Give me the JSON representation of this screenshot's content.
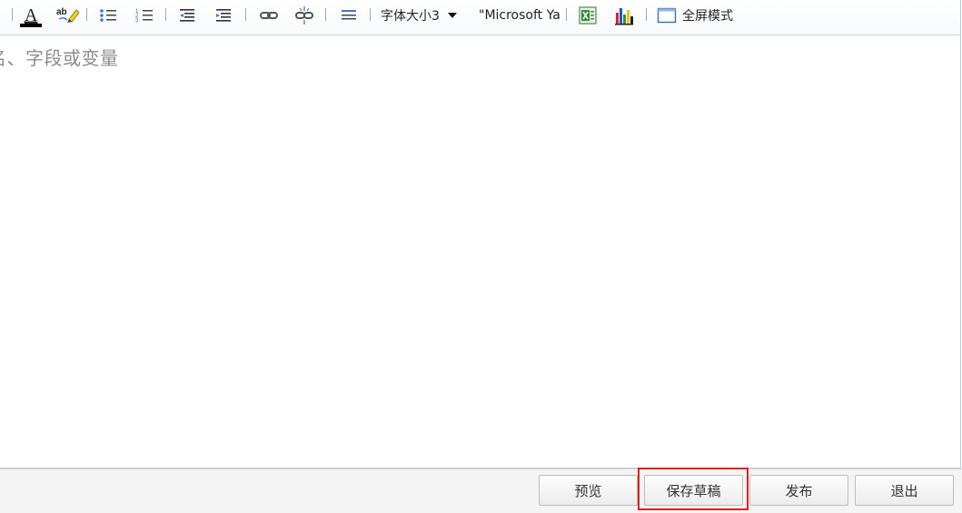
{
  "toolbar": {
    "font_size_label": "字体大小3",
    "font_family_label": "\"Microsoft Ya",
    "fullscreen_label": "全屏模式"
  },
  "editor": {
    "placeholder": "名、字段或变量"
  },
  "actions": {
    "preview_label": "预览",
    "save_draft_label": "保存草稿",
    "publish_label": "发布",
    "exit_label": "退出"
  },
  "colors": {
    "border_accent": "#b9cde6",
    "highlight": "#e02020"
  }
}
